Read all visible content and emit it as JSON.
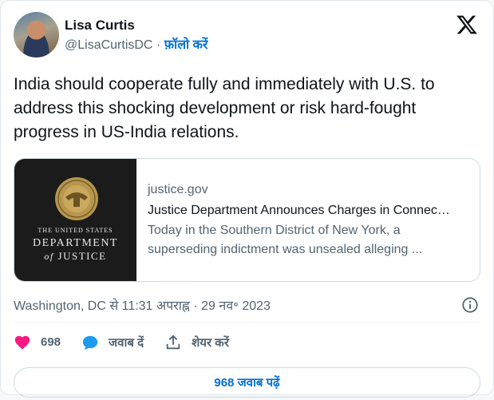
{
  "author": {
    "display_name": "Lisa Curtis",
    "handle": "@LisaCurtisDC",
    "separator": "·",
    "follow_label": "फ़ॉलो करें"
  },
  "tweet": {
    "text": "India should cooperate fully and immediately with U.S. to address this shocking development or risk hard-fought progress in US-India relations."
  },
  "link_card": {
    "thumb_line1": "THE UNITED STATES",
    "thumb_line2": "DEPARTMENT",
    "thumb_line3_of": "of",
    "thumb_line3": "JUSTICE",
    "domain": "justice.gov",
    "title": "Justice Department Announces Charges in Connec…",
    "description": "Today in the Southern District of New York, a superseding indictment was unsealed alleging ..."
  },
  "meta": {
    "timestamp": "Washington, DC से 11:31 अपराह्न · 29 नव॰ 2023"
  },
  "actions": {
    "like_count": "698",
    "reply_label": "जवाब दें",
    "share_label": "शेयर करें"
  },
  "replies_button": {
    "label": "968 जवाब पढ़ें"
  },
  "colors": {
    "like": "#f91880",
    "reply": "#1d9bf0",
    "link": "#006fd6",
    "muted": "#536471"
  },
  "icons": {
    "brand": "x-logo-icon",
    "info": "info-icon",
    "like": "heart-icon",
    "reply": "chat-bubble-icon",
    "share": "share-upload-icon"
  }
}
